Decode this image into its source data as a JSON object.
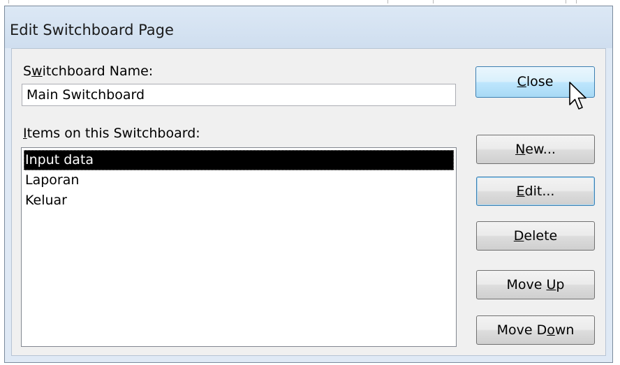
{
  "dialog": {
    "title": "Edit Switchboard Page"
  },
  "switchboard_name": {
    "label_pre": "S",
    "label_key": "w",
    "label_post": "itchboard Name:",
    "value": "Main Switchboard"
  },
  "items": {
    "label_pre": "",
    "label_key": "I",
    "label_post": "tems on this Switchboard:",
    "list": [
      {
        "label": "Input data",
        "selected": true
      },
      {
        "label": "Laporan",
        "selected": false
      },
      {
        "label": "Keluar",
        "selected": false
      }
    ]
  },
  "buttons": {
    "close": {
      "pre": "",
      "key": "C",
      "post": "lose",
      "state": "hover"
    },
    "new": {
      "pre": "",
      "key": "N",
      "post": "ew...",
      "state": "normal"
    },
    "edit": {
      "pre": "",
      "key": "E",
      "post": "dit...",
      "state": "focused"
    },
    "delete": {
      "pre": "",
      "key": "D",
      "post": "elete",
      "state": "normal"
    },
    "move_up": {
      "pre": "Move ",
      "key": "U",
      "post": "p",
      "state": "normal"
    },
    "move_down": {
      "pre": "Move D",
      "key": "o",
      "post": "wn",
      "state": "normal"
    }
  },
  "colors": {
    "dialog_background": "#f0f0f0",
    "frame": "#dfe9f5",
    "selection_background": "#000000",
    "selection_text": "#ffffff",
    "hover_button_accent": "#a7d9f5"
  },
  "cursor": {
    "icon": "arrow-cursor-icon"
  }
}
